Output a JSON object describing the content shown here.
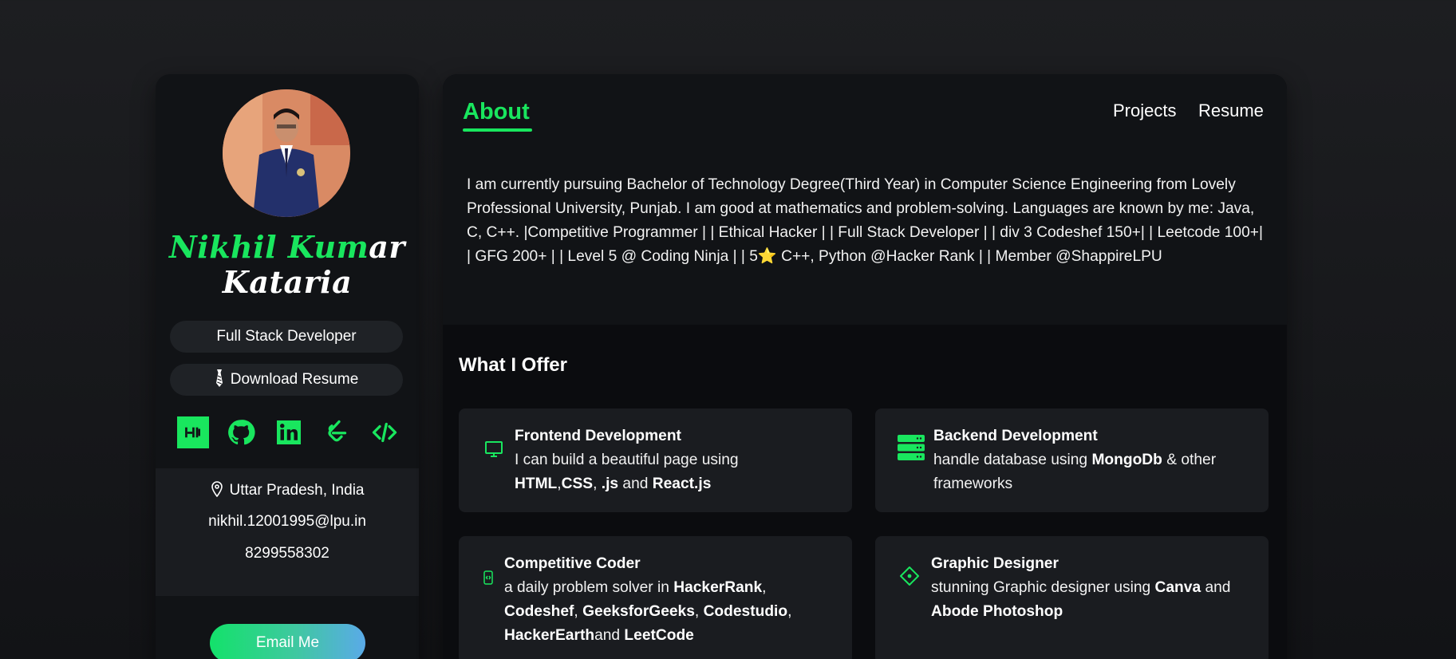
{
  "profile": {
    "name_green": "Nikhil Kum",
    "name_white_1": "ar",
    "name_white_2": "Kataria",
    "role": "Full Stack Developer",
    "resume_label": "Download Resume",
    "socials": [
      "hackernoon-icon",
      "github-icon",
      "linkedin-icon",
      "leetcode-icon",
      "code-icon"
    ],
    "location": "Uttar Pradesh, India",
    "email": "nikhil.12001995@lpu.in",
    "phone": "8299558302",
    "email_button": "Email Me"
  },
  "nav": {
    "active": "About",
    "projects": "Projects",
    "resume": "Resume"
  },
  "about": {
    "text": "I am currently pursuing Bachelor of Technology Degree(Third Year) in Computer Science Engineering from Lovely Professional University, Punjab. I am good at mathematics and problem-solving. Languages are known by me: Java, C, C++. |Competitive Programmer | | Ethical Hacker | | Full Stack Developer | | div 3 Codeshef 150+| | Leetcode 100+| | GFG 200+ | | Level 5 @ Coding Ninja | | 5⭐ C++, Python @Hacker Rank | | Member @ShappireLPU"
  },
  "offer": {
    "title": "What I Offer",
    "frontend": {
      "title": "Frontend Development",
      "pre": "I can build a beautiful page using",
      "b1": "HTML",
      "s1": ",",
      "b2": "CSS",
      "s2": ", ",
      "b3": ".js",
      "s3": " and ",
      "b4": "React.js"
    },
    "backend": {
      "title": "Backend Development",
      "pre": "handle database using ",
      "b1": "MongoDb",
      "post": " & other frameworks"
    },
    "competitive": {
      "title": "Competitive Coder",
      "pre": "a daily problem solver in ",
      "b1": "HackerRank",
      "s1": ",",
      "b2": "Codeshef",
      "s2": ", ",
      "b3": "GeeksforGeeks",
      "s3": ", ",
      "b4": "Codestudio",
      "s4": ",",
      "b5": "HackerEarth",
      "s5": "and ",
      "b6": "LeetCode"
    },
    "graphic": {
      "title": "Graphic Designer",
      "pre": "stunning Graphic designer using ",
      "b1": "Canva",
      "s1": " and",
      "b2": "Abode Photoshop"
    }
  },
  "colors": {
    "accent": "#19e65e",
    "card": "#1a1c20",
    "panel": "#111316"
  }
}
